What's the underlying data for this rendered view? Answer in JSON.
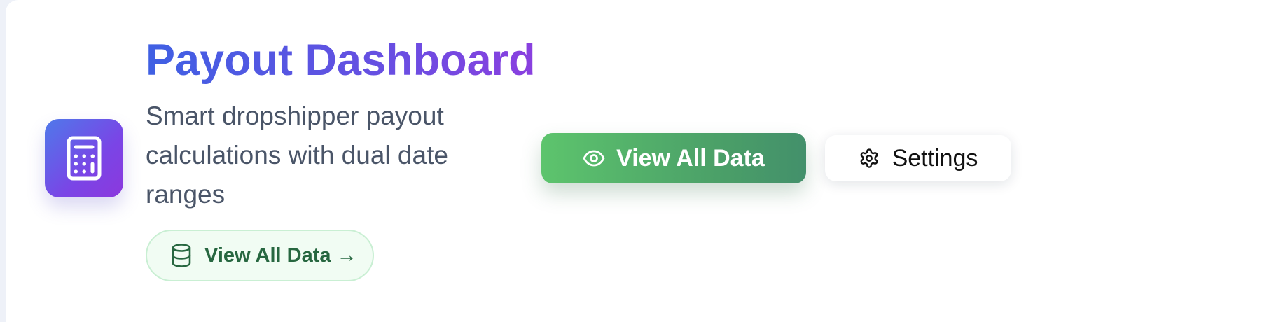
{
  "header": {
    "title": "Payout Dashboard",
    "subtitle": "Smart dropshipper payout calculations with dual date ranges",
    "app_icon": "calculator-icon"
  },
  "links": {
    "view_all_data_label": "View All Data →",
    "view_all_data_icon": "database-icon"
  },
  "actions": {
    "primary_label": "View All Data",
    "primary_icon": "eye-icon",
    "settings_label": "Settings",
    "settings_icon": "gear-icon"
  },
  "colors": {
    "title_gradient_start": "#3f60e3",
    "title_gradient_end": "#8a3fdf",
    "primary_button_start": "#5dc46d",
    "primary_button_end": "#43906b",
    "link_pill_text": "#276740",
    "subtitle_text": "#4a5568"
  }
}
